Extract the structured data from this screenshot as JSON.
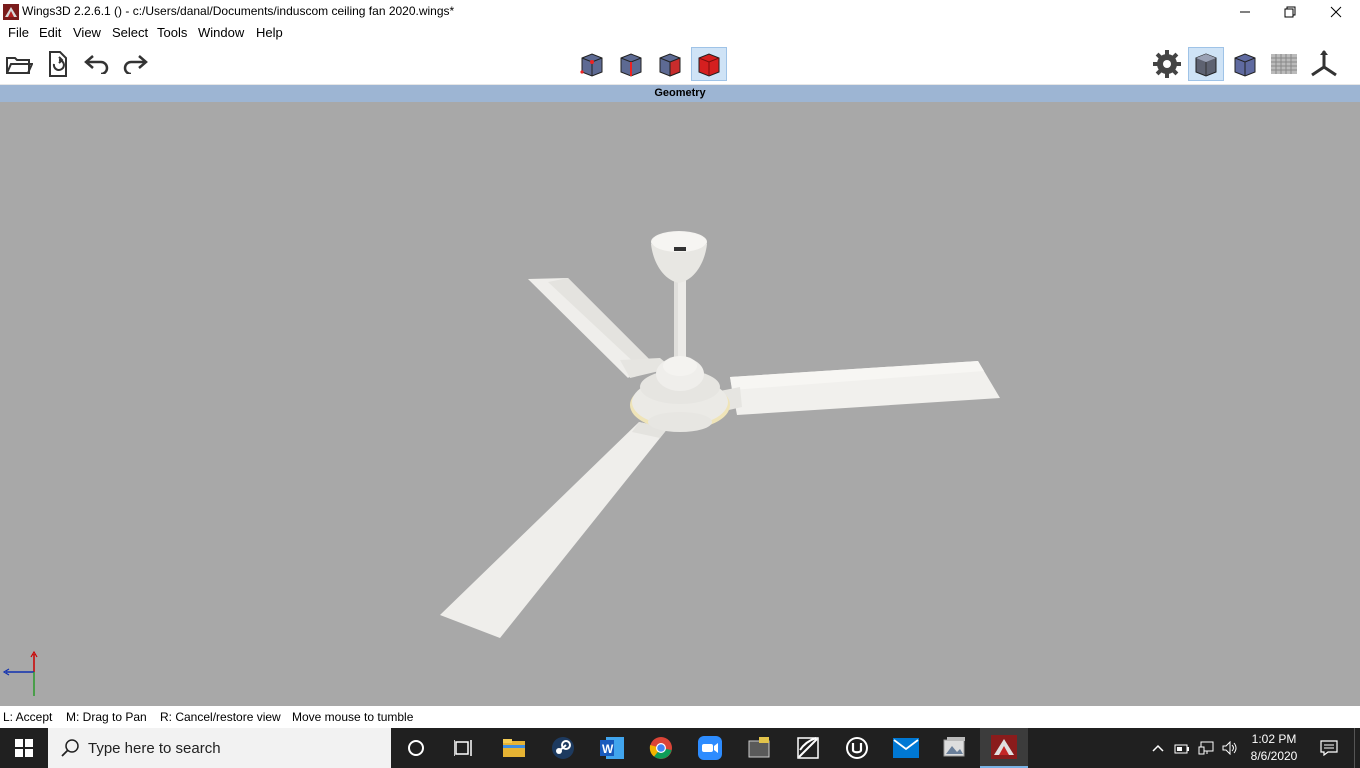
{
  "window": {
    "title": "Wings3D 2.2.6.1 () - c:/Users/danal/Documents/induscom ceiling fan 2020.wings*",
    "app_icon": "wings3d-icon"
  },
  "menu": {
    "items": [
      "File",
      "Edit",
      "View",
      "Select",
      "Tools",
      "Window",
      "Help"
    ]
  },
  "toolbar": {
    "left": [
      "open-icon",
      "save-icon",
      "undo-icon",
      "redo-icon"
    ],
    "selection_modes": [
      "vertex-mode",
      "edge-mode",
      "face-mode",
      "body-mode"
    ],
    "active_mode": "body-mode",
    "right": [
      "preferences-gear-icon",
      "smooth-shaded-icon",
      "flat-shaded-icon",
      "ground-plane-icon",
      "axes-icon"
    ]
  },
  "viewport": {
    "title": "Geometry",
    "model_color": "#f2f1ee",
    "background_color": "#a8a8a8"
  },
  "status": {
    "left": "L: Accept",
    "middle": "M: Drag to Pan",
    "right": "R: Cancel/restore view",
    "message": "Move mouse to tumble"
  },
  "taskbar": {
    "search_placeholder": "Type here to search",
    "apps": [
      "cortana-icon",
      "task-view-icon",
      "file-explorer-icon",
      "steam-icon",
      "word-icon",
      "chrome-icon",
      "zoom-icon",
      "app-icon",
      "pen-app-icon",
      "unreal-engine-icon",
      "mail-icon",
      "photos-icon",
      "wings3d-icon"
    ],
    "active_app": "wings3d-icon",
    "time": "1:02 PM",
    "date": "8/6/2020"
  }
}
